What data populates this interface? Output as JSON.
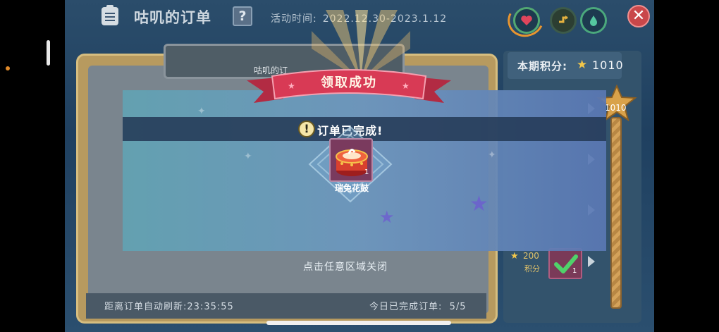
{
  "header": {
    "title": "咕叽的订单",
    "help_label": "?",
    "event_time_label": "活动时间:",
    "event_time_range": "2022.12.30-2023.1.12",
    "close_label": "✕"
  },
  "panel": {
    "tab_label": "咕叽的订",
    "refresh_label": "距离订单自动刷新:",
    "refresh_time": "23:35:55",
    "completed_label": "今日已完成订单:",
    "completed_count": "5/5"
  },
  "points": {
    "label": "本期积分:",
    "value": "1010",
    "progress_label": "1010"
  },
  "rewards": [
    {
      "points": "200",
      "unit": "积分",
      "count": "1",
      "claimed": true
    }
  ],
  "popup": {
    "banner": "领取成功",
    "notice": "订单已完成!",
    "notice_icon": "!",
    "item_name": "瑞兔花鼓",
    "item_count": "1",
    "close_hint": "点击任意区域关闭"
  },
  "colors": {
    "banner_red": "#c8324a",
    "gold_star": "#f2c64a",
    "close_red": "#c9474a",
    "panel_gold": "#b79a5f"
  },
  "icons": [
    "clipboard-icon",
    "question-icon",
    "heart-icon",
    "swap-icon",
    "water-drop-icon",
    "close-icon",
    "star-icon",
    "exclamation-icon",
    "chevron-right-icon",
    "checkmark-icon",
    "drum-cake-icon"
  ]
}
